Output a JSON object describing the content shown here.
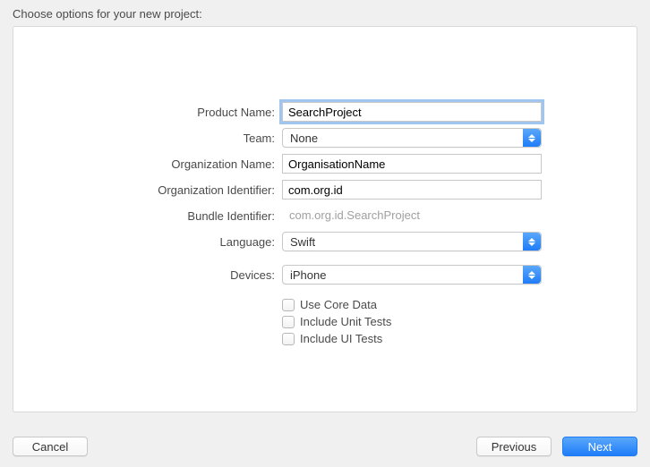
{
  "title": "Choose options for your new project:",
  "labels": {
    "productName": "Product Name:",
    "team": "Team:",
    "organizationName": "Organization Name:",
    "organizationIdentifier": "Organization Identifier:",
    "bundleIdentifier": "Bundle Identifier:",
    "language": "Language:",
    "devices": "Devices:"
  },
  "values": {
    "productName": "SearchProject",
    "team": "None",
    "organizationName": "OrganisationName",
    "organizationIdentifier": "com.org.id",
    "bundleIdentifier": "com.org.id.SearchProject",
    "language": "Swift",
    "devices": "iPhone"
  },
  "checkboxes": {
    "useCoreData": "Use Core Data",
    "includeUnitTests": "Include Unit Tests",
    "includeUITests": "Include UI Tests"
  },
  "buttons": {
    "cancel": "Cancel",
    "previous": "Previous",
    "next": "Next"
  }
}
